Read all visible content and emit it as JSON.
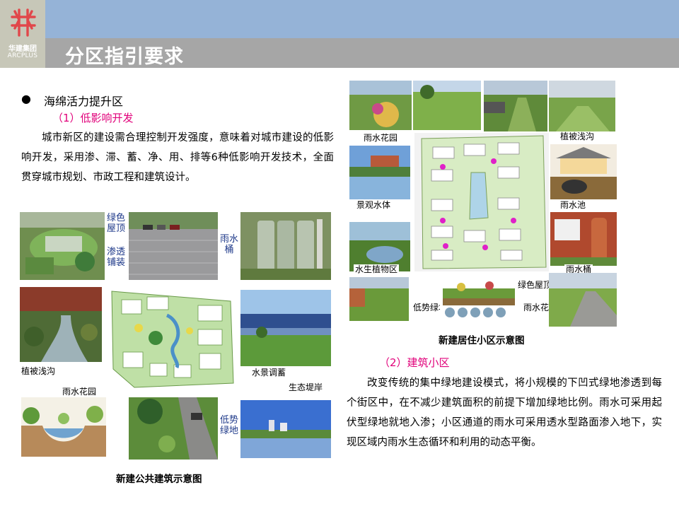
{
  "brand": {
    "name_cn": "华建集团",
    "name_en": "ARCPLUS",
    "logo_icon": "arcplus-logo-icon",
    "colors": {
      "band_blue": "#95b3d7",
      "band_gray": "#a6a6a6",
      "logo_bg": "#c7c7b8",
      "logo_red": "#e1474a",
      "accent_magenta": "#e1007a"
    }
  },
  "header": {
    "title": "分区指引要求"
  },
  "section": {
    "bullet": "●",
    "heading": "海绵活力提升区",
    "sub1": "（1）低影响开发",
    "para1": "城市新区的建设需合理控制开发强度，意味着对城市建设的低影响开发，采用渗、滞、蓄、净、用、排等6种低影响开发技术，全面贯穿城市规划、市政工程和建筑设计。",
    "sub2": "（2）建筑小区",
    "para2": "改变传统的集中绿地建设模式，将小规模的下凹式绿地渗透到每个街区中，在不减少建筑面积的前提下增加绿地比例。雨水可采用起伏型绿地就地入渗；小区通道的雨水可采用透水型路面渗入地下，实现区域内雨水生态循环和利用的动态平衡。"
  },
  "figure_public": {
    "caption": "新建公共建筑示意图",
    "labels": {
      "green_roof": "绿色屋顶",
      "permeable": "渗透铺装",
      "rain_tank": "雨水桶",
      "grass_swale": "植被浅沟",
      "rain_garden": "雨水花园",
      "water_storage": "水景调蓄",
      "eco_bank": "生态堤岸",
      "low_green": "低势绿地"
    }
  },
  "figure_residential": {
    "caption": "新建居住小区示意图",
    "labels": {
      "rain_garden": "雨水花园",
      "grass_swale": "植被浅沟",
      "landscape_water": "景观水体",
      "rain_pool": "雨水池",
      "aquatic_plants": "水生植物区",
      "rain_tank": "雨水桶",
      "green_roof": "绿色屋顶",
      "low_green": "低势绿地",
      "rain_garden2": "雨水花园"
    }
  }
}
